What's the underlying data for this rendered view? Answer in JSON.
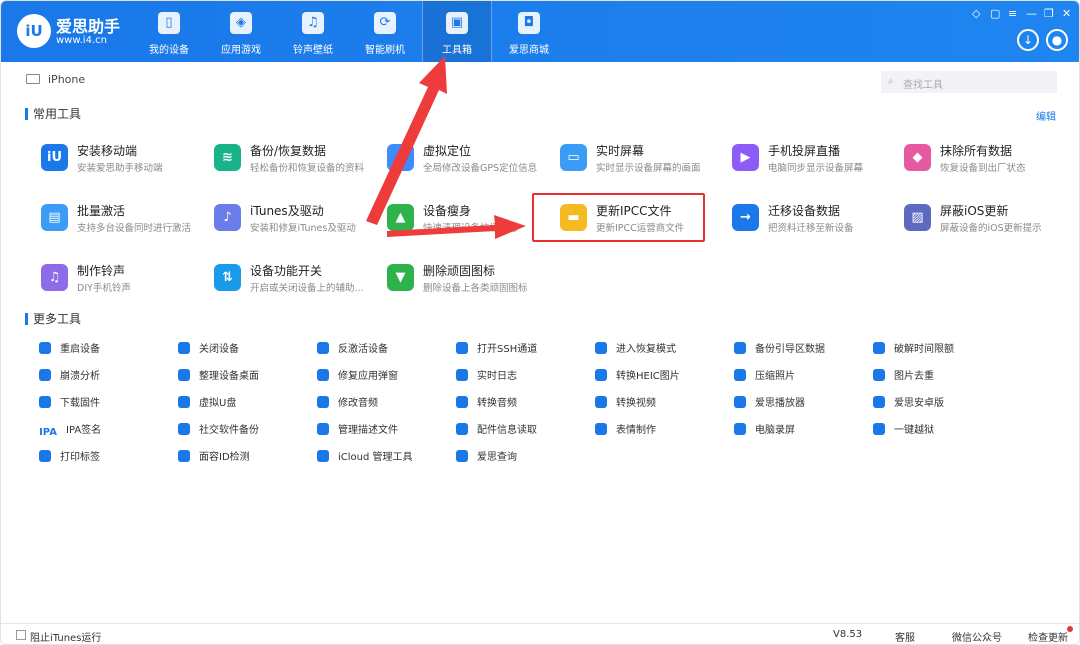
{
  "app": {
    "brand": "爱思助手",
    "domain": "www.i4.cn",
    "logo_text": "iU"
  },
  "nav": [
    {
      "label": "我的设备",
      "icon": "phone-icon"
    },
    {
      "label": "应用游戏",
      "icon": "cube-icon"
    },
    {
      "label": "铃声壁纸",
      "icon": "music-icon"
    },
    {
      "label": "智能刷机",
      "icon": "flash-icon"
    },
    {
      "label": "工具箱",
      "icon": "toolbox-icon",
      "active": true
    },
    {
      "label": "爱思商城",
      "icon": "bag-icon"
    }
  ],
  "window_controls": [
    "shirt-icon",
    "settings-icon",
    "minimize-icon",
    "maximize-icon",
    "close-icon"
  ],
  "device": {
    "name": "iPhone"
  },
  "search": {
    "placeholder": "查找工具"
  },
  "sections": {
    "common": "常用工具",
    "more": "更多工具",
    "edit": "编辑"
  },
  "common_tools": [
    {
      "name": "安装移动端",
      "desc": "安装爱思助手移动端",
      "color": "#1a78e8"
    },
    {
      "name": "备份/恢复数据",
      "desc": "轻松备份和恢复设备的资料",
      "color": "#19b38a"
    },
    {
      "name": "虚拟定位",
      "desc": "全局修改设备GPS定位信息",
      "color": "#3d8bfd"
    },
    {
      "name": "实时屏幕",
      "desc": "实时显示设备屏幕的画面",
      "color": "#3b9cf5"
    },
    {
      "name": "手机投屏直播",
      "desc": "电脑同步显示设备屏幕",
      "color": "#8b5cf6"
    },
    {
      "name": "抹除所有数据",
      "desc": "恢复设备到出厂状态",
      "color": "#e85aa0"
    },
    {
      "name": "批量激活",
      "desc": "支持多台设备同时进行激活",
      "color": "#3b9cf5"
    },
    {
      "name": "iTunes及驱动",
      "desc": "安装和修复iTunes及驱动",
      "color": "#6a7de8"
    },
    {
      "name": "设备瘦身",
      "desc": "快速清理设备垃圾信息",
      "color": "#2fb24c"
    },
    {
      "name": "更新IPCC文件",
      "desc": "更新IPCC运营商文件",
      "color": "#f5b921"
    },
    {
      "name": "迁移设备数据",
      "desc": "把资料迁移至新设备",
      "color": "#1a78e8"
    },
    {
      "name": "屏蔽iOS更新",
      "desc": "屏蔽设备的iOS更新提示",
      "color": "#5c6bc0"
    },
    {
      "name": "制作铃声",
      "desc": "DIY手机铃声",
      "color": "#8e6be8"
    },
    {
      "name": "设备功能开关",
      "desc": "开启或关闭设备上的辅助...",
      "color": "#1a9ae8"
    },
    {
      "name": "删除顽固图标",
      "desc": "删除设备上各类顽固图标",
      "color": "#2fb24c"
    }
  ],
  "more_tools": [
    [
      "重启设备",
      "关闭设备",
      "反激活设备",
      "打开SSH通道",
      "进入恢复模式",
      "备份引导区数据",
      "破解时间限额"
    ],
    [
      "崩溃分析",
      "整理设备桌面",
      "修复应用弹窗",
      "实时日志",
      "转换HEIC图片",
      "压缩照片",
      "图片去重"
    ],
    [
      "下载固件",
      "虚拟U盘",
      "修改音频",
      "转换音频",
      "转换视频",
      "爱思播放器",
      "爱思安卓版"
    ],
    [
      "IPA签名",
      "社交软件备份",
      "管理描述文件",
      "配件信息读取",
      "表情制作",
      "电脑录屏",
      "一键越狱"
    ],
    [
      "打印标签",
      "面容ID检测",
      "iCloud 管理工具",
      "爱思查询"
    ]
  ],
  "ipa_label": "IPA",
  "footer": {
    "itunes": "阻止iTunes运行",
    "version": "V8.53",
    "service": "客服",
    "wechat": "微信公众号",
    "update": "检查更新"
  }
}
